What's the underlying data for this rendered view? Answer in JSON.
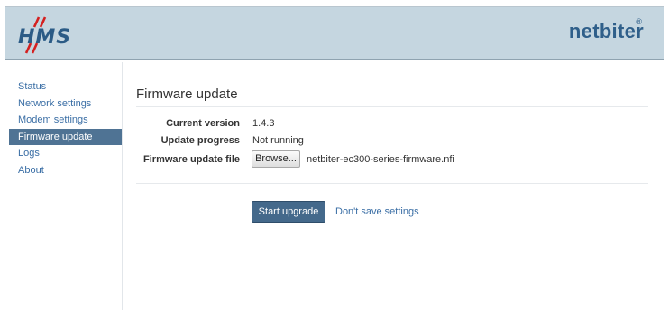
{
  "header": {
    "logo_text": "HMS",
    "brand_text": "netbiter",
    "brand_mark": "®"
  },
  "sidebar": {
    "items": [
      {
        "label": "Status"
      },
      {
        "label": "Network settings"
      },
      {
        "label": "Modem settings"
      },
      {
        "label": "Firmware update",
        "active": true
      },
      {
        "label": "Logs"
      },
      {
        "label": "About"
      }
    ]
  },
  "main": {
    "title": "Firmware update",
    "fields": [
      {
        "label": "Current version",
        "value": "1.4.3"
      },
      {
        "label": "Update progress",
        "value": "Not running"
      },
      {
        "label": "Firmware update file",
        "button_label": "Browse...",
        "file_name": "netbiter-ec300-series-firmware.nfi"
      }
    ],
    "primary_button": "Start upgrade",
    "secondary_link": "Don't save settings"
  },
  "colors": {
    "header_bg": "#c5d6e0",
    "brand": "#2f5f8a",
    "logo_accent": "#d42020",
    "nav_active_bg": "#4f7394",
    "link": "#3a6ea5",
    "primary_button_bg": "#44698b"
  }
}
